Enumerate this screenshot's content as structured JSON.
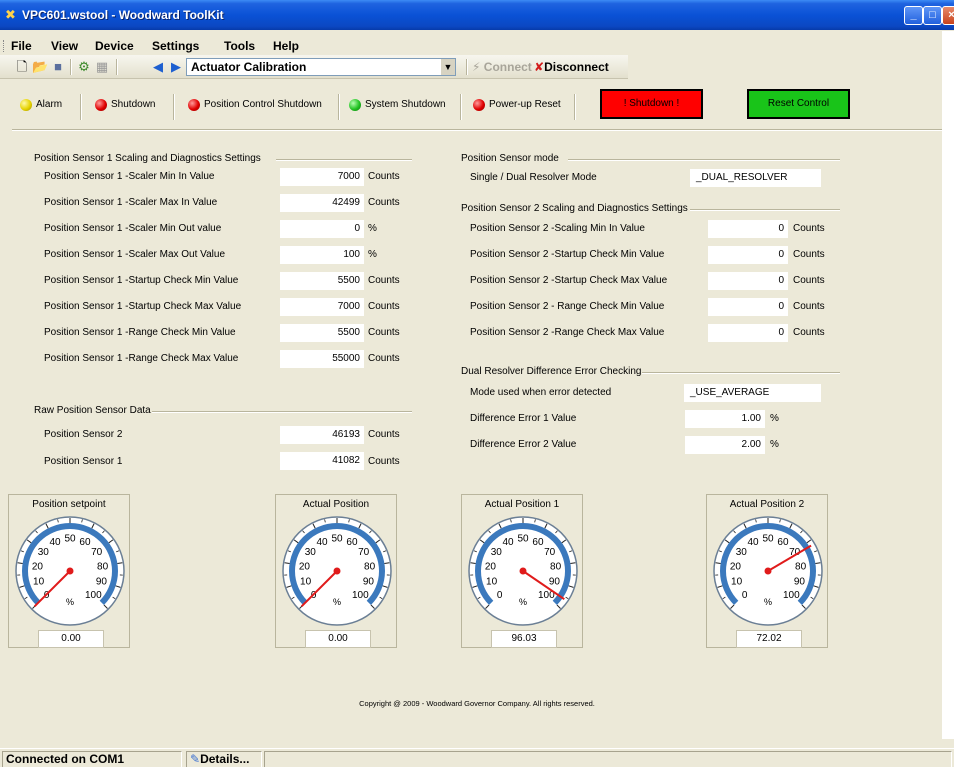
{
  "window": {
    "title": "VPC601.wstool - Woodward ToolKit"
  },
  "menu": {
    "items": [
      "File",
      "View",
      "Device",
      "Settings",
      "Tools",
      "Help"
    ]
  },
  "toolbar": {
    "page": "Actuator Calibration",
    "connect": "Connect",
    "disconnect": "Disconnect"
  },
  "indicators": [
    {
      "label": "Alarm",
      "color": "yellow"
    },
    {
      "label": "Shutdown",
      "color": "red"
    },
    {
      "label": "Position Control Shutdown",
      "color": "red"
    },
    {
      "label": "System Shutdown",
      "color": "green"
    },
    {
      "label": "Power-up Reset",
      "color": "red"
    }
  ],
  "buttons": {
    "shutdown": "! Shutdown !",
    "reset": "Reset Control"
  },
  "ps1": {
    "title": "Position Sensor 1 Scaling and Diagnostics Settings",
    "rows": [
      {
        "label": "Position Sensor 1 -Scaler Min In Value",
        "value": "7000",
        "unit": "Counts"
      },
      {
        "label": "Position Sensor 1 -Scaler Max In Value",
        "value": "42499",
        "unit": "Counts"
      },
      {
        "label": "Position Sensor 1 -Scaler Min Out value",
        "value": "0",
        "unit": "%"
      },
      {
        "label": "Position Sensor 1 -Scaler Max Out Value",
        "value": "100",
        "unit": "%"
      },
      {
        "label": "Position Sensor 1 -Startup Check Min Value",
        "value": "5500",
        "unit": "Counts"
      },
      {
        "label": "Position Sensor 1 -Startup Check Max Value",
        "value": "7000",
        "unit": "Counts"
      },
      {
        "label": "Position Sensor 1 -Range Check Min Value",
        "value": "5500",
        "unit": "Counts"
      },
      {
        "label": "Position Sensor 1 -Range Check Max Value",
        "value": "55000",
        "unit": "Counts"
      }
    ]
  },
  "raw": {
    "title": "Raw Position Sensor Data",
    "rows": [
      {
        "label": "Position Sensor 2",
        "value": "46193",
        "unit": "Counts"
      },
      {
        "label": "Position Sensor 1",
        "value": "41082",
        "unit": "Counts"
      }
    ]
  },
  "mode": {
    "title": "Position Sensor mode",
    "label": "Single / Dual Resolver Mode",
    "value": "_DUAL_RESOLVER"
  },
  "ps2": {
    "title": "Position Sensor 2 Scaling and Diagnostics Settings",
    "rows": [
      {
        "label": "Position Sensor 2 -Scaling Min In Value",
        "value": "0",
        "unit": "Counts"
      },
      {
        "label": "Position Sensor 2 -Startup Check Min Value",
        "value": "0",
        "unit": "Counts"
      },
      {
        "label": "Position Sensor 2 -Startup Check Max Value",
        "value": "0",
        "unit": "Counts"
      },
      {
        "label": "Position Sensor 2 - Range Check Min Value",
        "value": "0",
        "unit": "Counts"
      },
      {
        "label": "Position Sensor 2 -Range Check Max Value",
        "value": "0",
        "unit": "Counts"
      }
    ]
  },
  "dual": {
    "title": "Dual Resolver Difference Error Checking",
    "mode_label": "Mode used when error detected",
    "mode_value": "_USE_AVERAGE",
    "rows": [
      {
        "label": "Difference Error 1 Value",
        "value": "1.00",
        "unit": "%"
      },
      {
        "label": "Difference Error 2 Value",
        "value": "2.00",
        "unit": "%"
      }
    ]
  },
  "gauges": [
    {
      "title": "Position setpoint",
      "value": 0.0,
      "display": "0.00",
      "unit": "%"
    },
    {
      "title": "Actual Position",
      "value": 0.0,
      "display": "0.00",
      "unit": "%"
    },
    {
      "title": "Actual Position 1",
      "value": 96.03,
      "display": "96.03",
      "unit": "%"
    },
    {
      "title": "Actual Position 2",
      "value": 72.02,
      "display": "72.02",
      "unit": "%"
    }
  ],
  "gauge_ticks": [
    "0",
    "10",
    "20",
    "30",
    "40",
    "50",
    "60",
    "70",
    "80",
    "90",
    "100"
  ],
  "footer": {
    "copyright": "Copyright @ 2009 - Woodward Governor Company.  All rights reserved."
  },
  "status": {
    "connection": "Connected on COM1",
    "details": "Details..."
  }
}
